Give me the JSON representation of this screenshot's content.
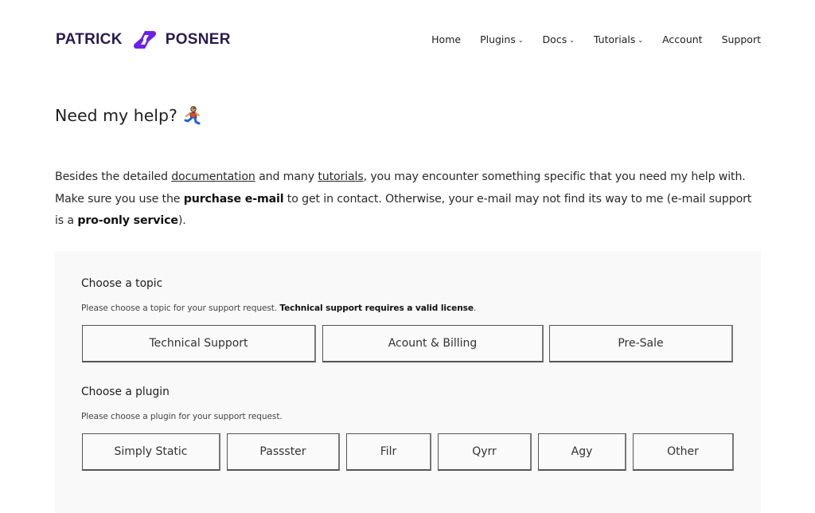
{
  "header": {
    "logo": {
      "left_text": "PATRICK",
      "right_text": "POSNER",
      "icon": "pp-logo-icon",
      "brand_color": "#6b21e8",
      "text_color": "#2a1b4d"
    },
    "nav": [
      {
        "label": "Home",
        "has_dropdown": false
      },
      {
        "label": "Plugins",
        "has_dropdown": true
      },
      {
        "label": "Docs",
        "has_dropdown": true
      },
      {
        "label": "Tutorials",
        "has_dropdown": true
      },
      {
        "label": "Account",
        "has_dropdown": false
      },
      {
        "label": "Support",
        "has_dropdown": false
      }
    ],
    "dropdown_icon": "⌄"
  },
  "main": {
    "title": "Need my help?",
    "title_icon": "running-person-icon",
    "intro": {
      "p1_a": "Besides the detailed ",
      "link_docs": "documentation",
      "p1_b": " and many ",
      "link_tutorials": "tutorials",
      "p1_c": ", you may encounter something specific that you need my help with. Make sure you use the ",
      "bold_email": "purchase e-mail",
      "p1_d": " to get in contact. Otherwise, your e-mail may not find its way to me (e-mail support is a ",
      "bold_pro": "pro-only service",
      "p1_e": ")."
    },
    "topic": {
      "title": "Choose a topic",
      "help": "Please choose a topic for your support request. ",
      "help_bold": "Technical support requires a valid license",
      "help_end": ".",
      "options": [
        "Technical Support",
        "Acount & Billing",
        "Pre-Sale"
      ]
    },
    "plugin": {
      "title": "Choose a plugin",
      "help": "Please choose a plugin for your support request.",
      "options": [
        "Simply Static",
        "Passster",
        "Filr",
        "Qyrr",
        "Agy",
        "Other"
      ]
    }
  }
}
